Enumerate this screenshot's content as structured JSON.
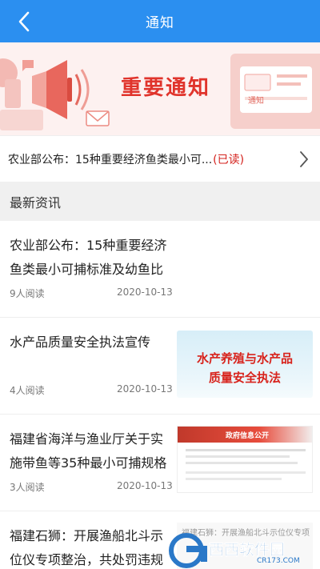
{
  "header": {
    "title": "通知",
    "bg_color": "#2b8ff0"
  },
  "banner": {
    "title": "重要通知",
    "badge_text": "通知"
  },
  "notice": {
    "text": "农业部公布：15种重要经济鱼类最小可...",
    "status": "(已读)"
  },
  "section": {
    "title": "最新资讯"
  },
  "news": [
    {
      "title": "农业部公布：15种重要经济鱼类最小可捕标准及幼鱼比",
      "reads": "9人阅读",
      "date": "2020-10-13"
    },
    {
      "title": "水产品质量安全执法宣传",
      "reads": "4人阅读",
      "date": "2020-10-13",
      "thumb_text_1": "水产养殖与水产品",
      "thumb_text_2": "质量安全执法"
    },
    {
      "title": "福建省海洋与渔业厅关于实施带鱼等35种最小可捕规格",
      "reads": "3人阅读",
      "date": "2020-10-13",
      "thumb_text_1": "政府信息公开"
    },
    {
      "title": "福建石狮：开展渔船北斗示位仪专项整治，共处罚违规",
      "thumb_text_1": "福建石狮：开展渔船北斗示位仪专项"
    }
  ],
  "watermark": {
    "brand": "西西软件园",
    "domain": "CR173.COM"
  }
}
